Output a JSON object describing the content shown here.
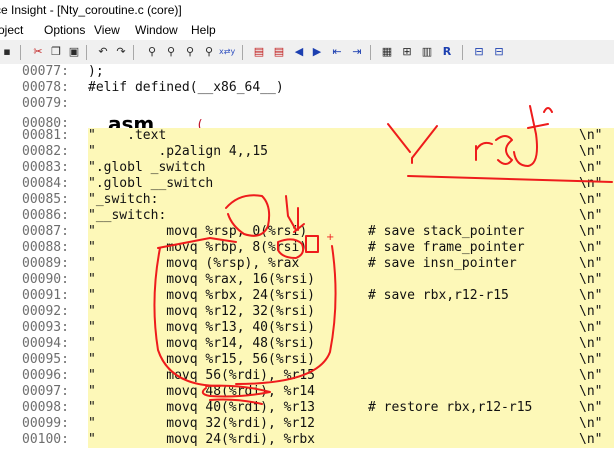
{
  "window": {
    "title": "rce Insight - [Nty_coroutine.c (core)]"
  },
  "menu": {
    "items": [
      "roject",
      "Options",
      "View",
      "Window",
      "Help"
    ]
  },
  "toolbar": {
    "icons": [
      "save-icon",
      "cut-icon",
      "copy-icon",
      "paste-icon",
      "undo-icon",
      "redo-icon",
      "find-icon",
      "find-prev-icon",
      "find-next-icon",
      "find-files-icon",
      "replace-icon",
      "bookmark-toggle-icon",
      "bookmark-list-icon",
      "back-icon",
      "forward-icon",
      "jump-prev-icon",
      "jump-next-icon",
      "symbol-window-icon",
      "relation-icon",
      "browse-icon",
      "lookup-icon",
      "tile-icon",
      "split-icon"
    ]
  },
  "code": {
    "lines": [
      {
        "no": "00077:",
        "text": ");",
        "hl": false
      },
      {
        "no": "00078:",
        "text": "#elif defined(__x86_64__)",
        "hl": false
      },
      {
        "no": "00079:",
        "text": "",
        "hl": false
      },
      {
        "no": "00080:",
        "text": "__asm__",
        "paren": "(",
        "hl": false,
        "asm": true
      },
      {
        "no": "00081:",
        "text": "\"    .text",
        "nl": "\\n\"",
        "hl": true
      },
      {
        "no": "00082:",
        "text": "\"        .p2align 4,,15",
        "nl": "\\n\"",
        "hl": true
      },
      {
        "no": "00083:",
        "text": "\".globl _switch",
        "nl": "\\n\"",
        "hl": true
      },
      {
        "no": "00084:",
        "text": "\".globl __switch",
        "nl": "\\n\"",
        "hl": true
      },
      {
        "no": "00085:",
        "text": "\"_switch:",
        "nl": "\\n\"",
        "hl": true
      },
      {
        "no": "00086:",
        "text": "\"__switch:",
        "nl": "\\n\"",
        "hl": true
      },
      {
        "no": "00087:",
        "text": "\"         movq %rsp, 0(%rsi)",
        "comment": "# save stack_pointer",
        "nl": "\\n\"",
        "hl": true
      },
      {
        "no": "00088:",
        "text": "\"         movq %rbp, 8(%rsi)",
        "comment": "# save frame_pointer",
        "nl": "\\n\"",
        "hl": true
      },
      {
        "no": "00089:",
        "text": "\"         movq (%rsp), %rax",
        "comment": "# save insn_pointer",
        "nl": "\\n\"",
        "hl": true
      },
      {
        "no": "00090:",
        "text": "\"         movq %rax, 16(%rsi)",
        "nl": "\\n\"",
        "hl": true
      },
      {
        "no": "00091:",
        "text": "\"         movq %rbx, 24(%rsi)",
        "comment": "# save rbx,r12-r15",
        "nl": "\\n\"",
        "hl": true
      },
      {
        "no": "00092:",
        "text": "\"         movq %r12, 32(%rsi)",
        "nl": "\\n\"",
        "hl": true
      },
      {
        "no": "00093:",
        "text": "\"         movq %r13, 40(%rsi)",
        "nl": "\\n\"",
        "hl": true
      },
      {
        "no": "00094:",
        "text": "\"         movq %r14, 48(%rsi)",
        "nl": "\\n\"",
        "hl": true
      },
      {
        "no": "00095:",
        "text": "\"         movq %r15, 56(%rsi)",
        "nl": "\\n\"",
        "hl": true
      },
      {
        "no": "00096:",
        "text": "\"         movq 56(%rdi), %r15",
        "nl": "\\n\"",
        "hl": true
      },
      {
        "no": "00097:",
        "text": "\"         movq 48(%rdi), %r14",
        "nl": "\\n\"",
        "hl": true
      },
      {
        "no": "00098:",
        "text": "\"         movq 40(%rdi), %r13",
        "comment": "# restore rbx,r12-r15",
        "nl": "\\n\"",
        "hl": true
      },
      {
        "no": "00099:",
        "text": "\"         movq 32(%rdi), %r12",
        "nl": "\\n\"",
        "hl": true
      },
      {
        "no": "00100:",
        "text": "\"         movq 24(%rdi), %rbx",
        "nl": "\\n\"",
        "hl": true
      }
    ]
  },
  "annotation": {
    "text": "Y r s J"
  },
  "colors": {
    "highlight": "#fdf8b8",
    "annotation": "#ee1c1c",
    "paren": "#c0182d",
    "lineno": "#6e6e6e"
  }
}
